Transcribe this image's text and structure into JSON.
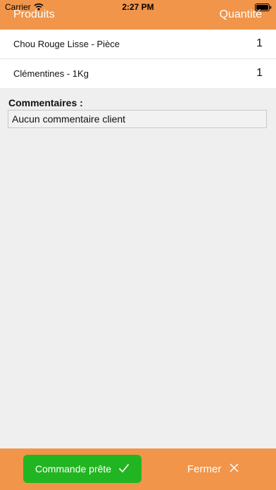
{
  "status_bar": {
    "carrier": "Carrier",
    "time": "2:27 PM"
  },
  "header": {
    "products_label": "Produits",
    "quantity_label": "Quantité",
    "color": "#f0954a"
  },
  "items": [
    {
      "name": "Chou Rouge Lisse - Pièce",
      "quantity": "1"
    },
    {
      "name": "Clémentines - 1Kg",
      "quantity": "1"
    }
  ],
  "comments": {
    "label": "Commentaires :",
    "value": "Aucun commentaire client"
  },
  "footer": {
    "ready_label": "Commande prête",
    "ready_icon": "checkmark-icon",
    "ready_color": "#22b522",
    "close_label": "Fermer",
    "close_icon": "close-icon"
  }
}
